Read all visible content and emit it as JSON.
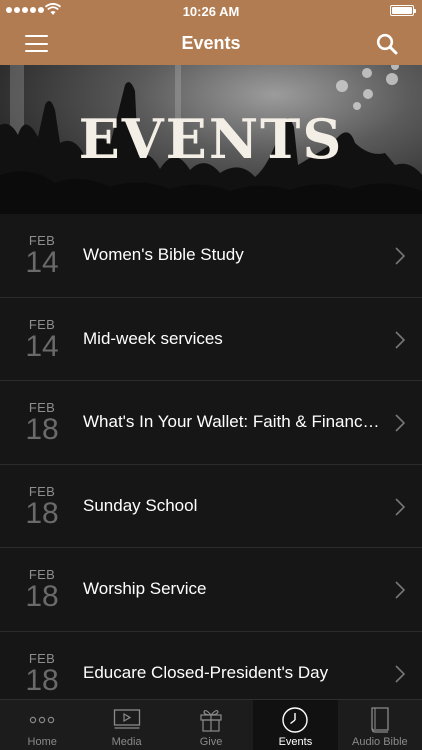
{
  "status_bar": {
    "time": "10:26 AM",
    "signal_bars": 5
  },
  "nav_bar": {
    "title": "Events",
    "left_icon": "menu-icon",
    "right_icon": "search-icon"
  },
  "hero": {
    "heading": "EVENTS"
  },
  "events": [
    {
      "month": "FEB",
      "day": "14",
      "title": "Women's Bible Study"
    },
    {
      "month": "FEB",
      "day": "14",
      "title": "Mid-week services"
    },
    {
      "month": "FEB",
      "day": "18",
      "title": "What's In Your Wallet: Faith & Finance..."
    },
    {
      "month": "FEB",
      "day": "18",
      "title": "Sunday School"
    },
    {
      "month": "FEB",
      "day": "18",
      "title": "Worship Service"
    },
    {
      "month": "FEB",
      "day": "18",
      "title": "Educare Closed-President's Day"
    }
  ],
  "tab_bar": {
    "active": "Events",
    "tabs": [
      {
        "label": "Home",
        "icon": "more-dots-icon"
      },
      {
        "label": "Media",
        "icon": "video-icon"
      },
      {
        "label": "Give",
        "icon": "gift-icon"
      },
      {
        "label": "Events",
        "icon": "clock-icon"
      },
      {
        "label": "Audio Bible",
        "icon": "book-icon"
      }
    ]
  },
  "colors": {
    "brand": "#b27c52",
    "background": "#161616",
    "tab_bar": "#1c1c1c"
  }
}
